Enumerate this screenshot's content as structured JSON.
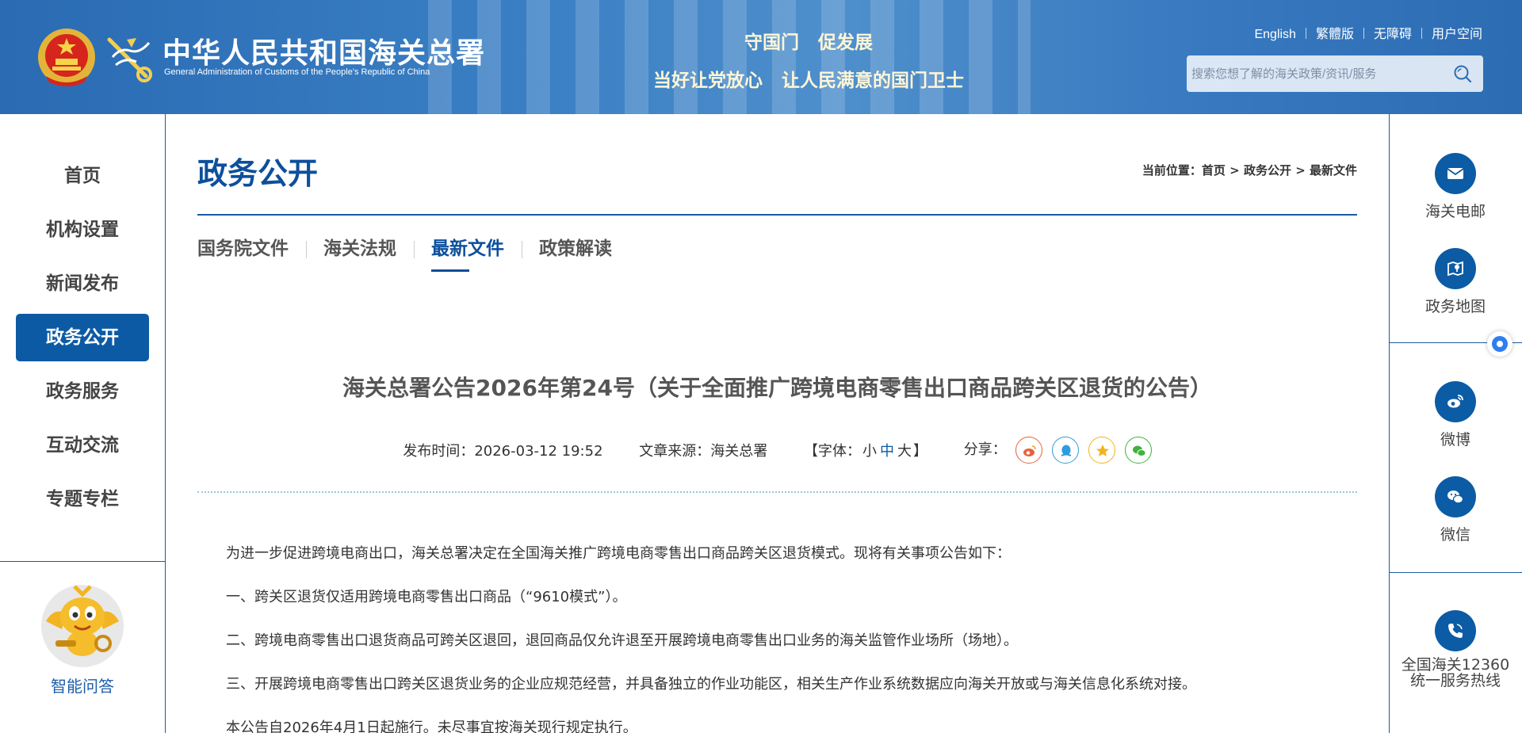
{
  "header": {
    "brand_cn": "中华人民共和国海关总署",
    "brand_en": "General Administration of Customs of the People's Republic of China",
    "slogan_line1": [
      "守国门",
      "促发展"
    ],
    "slogan_line2": [
      "当好让党放心",
      "让人民满意的国门卫士"
    ],
    "top_links": [
      "English",
      "繁體版",
      "无障碍",
      "用户空间"
    ],
    "search_placeholder": "搜索您想了解的海关政策/资讯/服务"
  },
  "left_nav": {
    "items": [
      "首页",
      "机构设置",
      "新闻发布",
      "政务公开",
      "政务服务",
      "互动交流",
      "专题专栏"
    ],
    "active_index": 3,
    "assistant_label": "智能问答"
  },
  "right_bar": {
    "items": [
      "海关电邮",
      "政务地图",
      "微博",
      "微信"
    ],
    "hotline": [
      "全国海关12360",
      "统一服务热线"
    ]
  },
  "main": {
    "section_title": "政务公开",
    "breadcrumb": {
      "prefix": "当前位置：",
      "items": [
        "首页",
        "政务公开",
        "最新文件"
      ],
      "separator": " > "
    },
    "tabs": [
      "国务院文件",
      "海关法规",
      "最新文件",
      "政策解读"
    ],
    "active_tab": 2,
    "article": {
      "title": "海关总署公告2026年第24号（关于全面推广跨境电商零售出口商品跨关区退货的公告）",
      "publish_time_label": "发布时间：",
      "publish_time": "2026-03-12 19:52",
      "source_label": "文章来源：",
      "source": "海关总署",
      "font_size_prefix": "【字体：",
      "font_sizes": [
        "小",
        "中",
        "大"
      ],
      "font_size_suffix": "】",
      "share_label": "分享：",
      "paragraphs": [
        "为进一步促进跨境电商出口，海关总署决定在全国海关推广跨境电商零售出口商品跨关区退货模式。现将有关事项公告如下：",
        "一、跨关区退货仅适用跨境电商零售出口商品（“9610模式”）。",
        "二、跨境电商零售出口退货商品可跨关区退回，退回商品仅允许退至开展跨境电商零售出口业务的海关监管作业场所（场地）。",
        "三、开展跨境电商零售出口跨关区退货业务的企业应规范经营，并具备独立的作业功能区，相关生产作业系统数据应向海关开放或与海关信息化系统对接。",
        "本公告自2026年4月1日起施行。未尽事宜按海关现行规定执行。"
      ]
    }
  },
  "colors": {
    "primary_blue": "#0d5aa4",
    "header_blue": "#3a7fc4",
    "title_blue": "#0d4f9c",
    "weibo": "#e8623b",
    "qq": "#2d9ce0",
    "qzone": "#f2b31c",
    "wechat": "#3fb33f"
  }
}
